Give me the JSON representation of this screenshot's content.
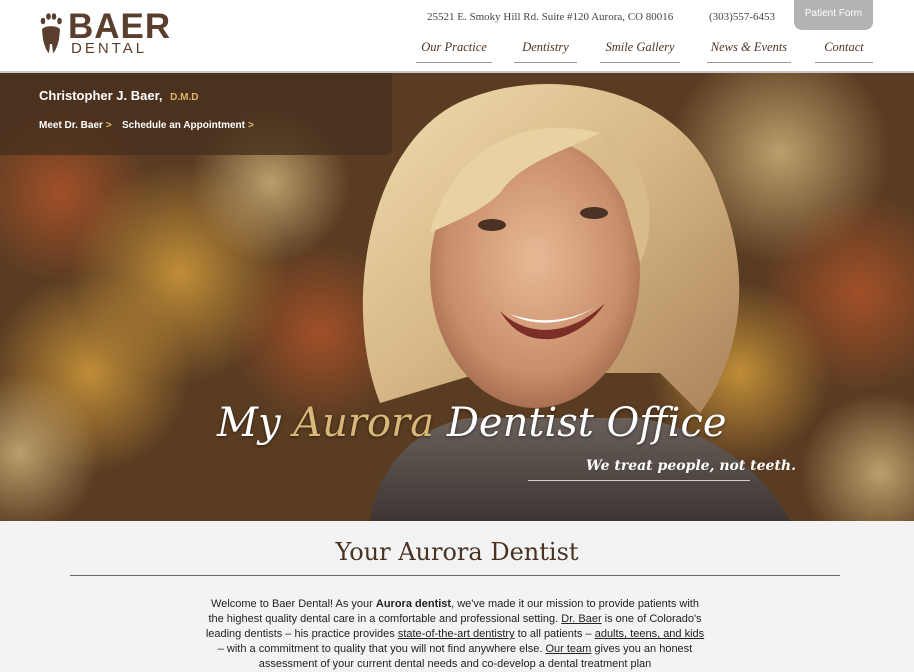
{
  "header": {
    "logo_word": "BAER",
    "logo_sub": "DENTAL",
    "address": "25521 E. Smoky Hill Rd. Suite #120 Aurora, CO 80016",
    "phone": "(303)557-6453",
    "patient_form": "Patient Form"
  },
  "nav": [
    {
      "label": "Our Practice"
    },
    {
      "label": "Dentistry"
    },
    {
      "label": "Smile Gallery"
    },
    {
      "label": "News & Events"
    },
    {
      "label": "Contact"
    }
  ],
  "infobox": {
    "name": "Christopher J. Baer,",
    "credential": "D.M.D",
    "link1": "Meet Dr. Baer",
    "link2": "Schedule an Appointment",
    "arrow": ">"
  },
  "hero": {
    "title_pre": "My ",
    "title_accent": "Aurora",
    "title_post": " Dentist Office",
    "tagline": "We treat people, not teeth."
  },
  "section": {
    "title": "Your Aurora Dentist"
  },
  "body": {
    "s1": "Welcome to Baer Dental! As your ",
    "s2": "Aurora dentist",
    "s3": ", we've made it our mission to provide patients with the highest quality dental care in a comfortable and professional setting. ",
    "s4": "Dr. Baer",
    "s5": " is one of Colorado's leading dentists – his practice provides ",
    "s6": "state-of-the-art dentistry",
    "s7": " to all patients – ",
    "s8": "adults, teens, and kids",
    "s9": " – with a commitment to quality that you will not find anywhere else. ",
    "s10": "Our team",
    "s11": " gives you an honest assessment of your current dental needs and co-develop a dental treatment plan"
  },
  "colors": {
    "brand_brown": "#5a3f2f",
    "accent_gold": "#d8b878",
    "page_bg": "#f3f3f3"
  }
}
